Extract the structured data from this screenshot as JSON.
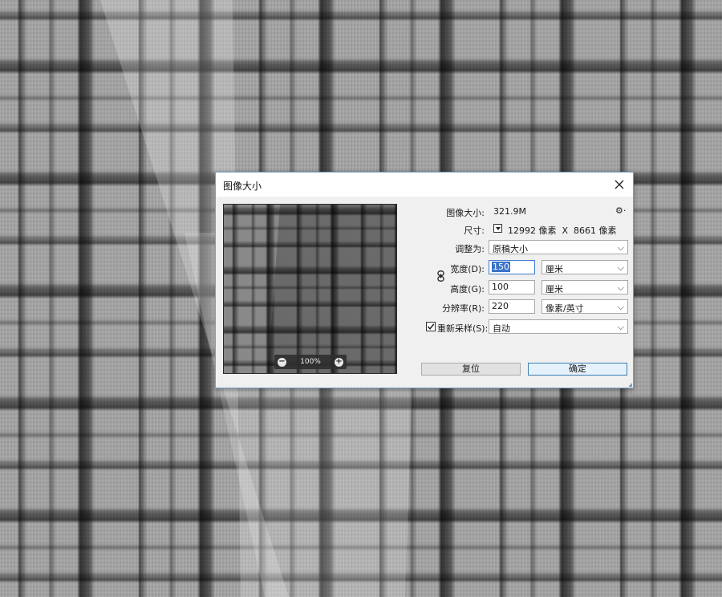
{
  "dialog": {
    "title": "图像大小",
    "close_icon": "close-icon"
  },
  "preview": {
    "zoom_level": "100%",
    "zoom_out_icon": "zoom-out-icon",
    "zoom_in_icon": "zoom-in-icon"
  },
  "info": {
    "image_size_label": "图像大小:",
    "image_size_value": "321.9M",
    "settings_icon": "gear-icon",
    "dimensions_label": "尺寸:",
    "dimensions_value": "12992 像素  X  8661 像素"
  },
  "fit_to": {
    "label": "调整为:",
    "value": "原稿大小"
  },
  "width": {
    "label": "宽度(D):",
    "value": "150",
    "unit": "厘米"
  },
  "height": {
    "label": "高度(G):",
    "value": "100",
    "unit": "厘米"
  },
  "resolution": {
    "label": "分辨率(R):",
    "value": "220",
    "unit": "像素/英寸"
  },
  "resample": {
    "label": "重新采样(S):",
    "checked": true,
    "value": "自动"
  },
  "buttons": {
    "reset": "复位",
    "ok": "确定"
  },
  "colors": {
    "accent": "#3a73c8",
    "dialog_bg": "#f0f0f0",
    "border": "#7a9cc6"
  }
}
